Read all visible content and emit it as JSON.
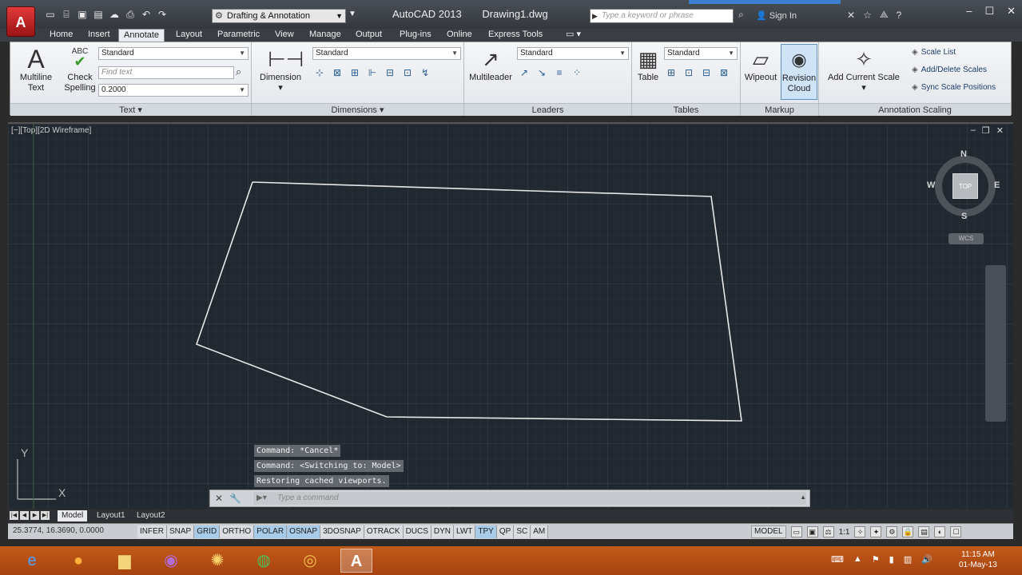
{
  "app": {
    "logo_letter": "A",
    "title": "AutoCAD 2013",
    "document": "Drawing1.dwg",
    "workspace": "Drafting & Annotation",
    "search_placeholder": "Type a keyword or phrase",
    "sign_in": "Sign In"
  },
  "tabs": [
    {
      "label": "Home"
    },
    {
      "label": "Insert"
    },
    {
      "label": "Annotate"
    },
    {
      "label": "Layout"
    },
    {
      "label": "Parametric"
    },
    {
      "label": "View"
    },
    {
      "label": "Manage"
    },
    {
      "label": "Output"
    },
    {
      "label": "Plug-ins"
    },
    {
      "label": "Online"
    },
    {
      "label": "Express Tools"
    }
  ],
  "ribbon": {
    "text_panel": {
      "title": "Text",
      "multiline_text_line1": "Multiline",
      "multiline_text_line2": "Text",
      "check_spelling_line1": "Check",
      "check_spelling_line2": "Spelling",
      "abc": "ABC",
      "style": "Standard",
      "find_placeholder": "Find text",
      "height": "0.2000"
    },
    "dimensions_panel": {
      "title": "Dimensions",
      "dimension_label": "Dimension",
      "style": "Standard"
    },
    "leaders_panel": {
      "title": "Leaders",
      "multileader_label": "Multileader",
      "style": "Standard"
    },
    "tables_panel": {
      "title": "Tables",
      "table_label": "Table",
      "style": "Standard"
    },
    "markup_panel": {
      "title": "Markup",
      "wipeout_label": "Wipeout",
      "revcloud_line1": "Revision",
      "revcloud_line2": "Cloud"
    },
    "annotation_scaling_panel": {
      "title": "Annotation Scaling",
      "add_current_scale": "Add Current Scale",
      "scale_list": "Scale List",
      "add_delete_scales": "Add/Delete Scales",
      "sync_scale_positions": "Sync Scale Positions"
    }
  },
  "viewport": {
    "label": "[−][Top][2D Wireframe]",
    "viewcube": {
      "north": "N",
      "south": "S",
      "east": "E",
      "west": "W",
      "top": "TOP"
    },
    "wcs": "WCS",
    "ucs_x": "X",
    "ucs_y": "Y"
  },
  "command": {
    "history": [
      "Command: *Cancel*",
      "Command:   <Switching to: Model>",
      "Restoring cached viewports."
    ],
    "placeholder": "Type a command"
  },
  "layout_tabs": [
    {
      "label": "Model"
    },
    {
      "label": "Layout1"
    },
    {
      "label": "Layout2"
    }
  ],
  "status": {
    "coords": "25.3774, 16.3690, 0.0000",
    "toggles": [
      {
        "label": "INFER",
        "on": false
      },
      {
        "label": "SNAP",
        "on": false
      },
      {
        "label": "GRID",
        "on": true
      },
      {
        "label": "ORTHO",
        "on": false
      },
      {
        "label": "POLAR",
        "on": true
      },
      {
        "label": "OSNAP",
        "on": true
      },
      {
        "label": "3DOSNAP",
        "on": false
      },
      {
        "label": "OTRACK",
        "on": false
      },
      {
        "label": "DUCS",
        "on": false
      },
      {
        "label": "DYN",
        "on": false
      },
      {
        "label": "LWT",
        "on": false
      },
      {
        "label": "TPY",
        "on": true
      },
      {
        "label": "QP",
        "on": false
      },
      {
        "label": "SC",
        "on": false
      },
      {
        "label": "AM",
        "on": false
      }
    ],
    "model": "MODEL",
    "scale": "1:1"
  },
  "taskbar": {
    "time": "11:15 AM",
    "date": "01-May-13"
  },
  "colors": {
    "canvas": "#212830",
    "geometry": "#e8e8e8",
    "ribbon": "#e9ecf0",
    "taskbar": "#b84e14",
    "accent": "#3c7fd0"
  }
}
